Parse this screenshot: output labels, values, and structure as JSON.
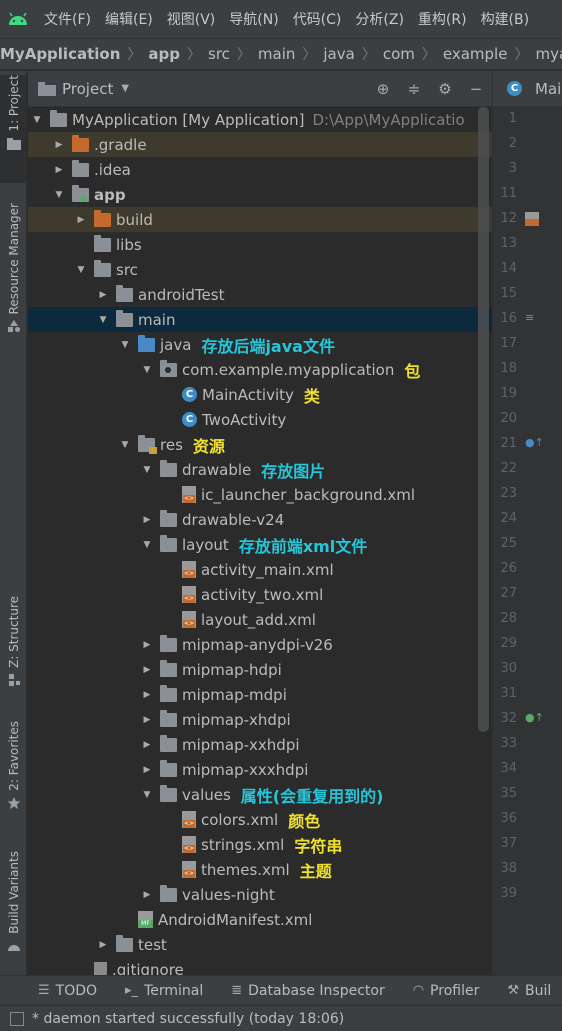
{
  "menubar": {
    "items": [
      "文件(F)",
      "编辑(E)",
      "视图(V)",
      "导航(N)",
      "代码(C)",
      "分析(Z)",
      "重构(R)",
      "构建(B)"
    ]
  },
  "breadcrumb": [
    "MyApplication",
    "app",
    "src",
    "main",
    "java",
    "com",
    "example",
    "myapplicatio"
  ],
  "sidebar": {
    "tabs": [
      "1: Project",
      "Resource Manager",
      "Z: Structure",
      "2: Favorites",
      "Build Variants"
    ]
  },
  "project_panel": {
    "title": "Project",
    "tree": [
      {
        "label": "MyApplication [My Application]",
        "path": "D:\\App\\MyApplicatio",
        "depth": 0,
        "icon": "folder-gray",
        "arrow": "open"
      },
      {
        "label": ".gradle",
        "depth": 1,
        "icon": "folder-orange",
        "arrow": "closed",
        "hl": true
      },
      {
        "label": ".idea",
        "depth": 1,
        "icon": "folder-gray",
        "arrow": "closed"
      },
      {
        "label": "app",
        "depth": 1,
        "icon": "folder-app",
        "arrow": "open",
        "bold": true
      },
      {
        "label": "build",
        "depth": 2,
        "icon": "folder-orange",
        "arrow": "closed",
        "hl": true
      },
      {
        "label": "libs",
        "depth": 2,
        "icon": "folder-gray",
        "arrow": "none"
      },
      {
        "label": "src",
        "depth": 2,
        "icon": "folder-gray",
        "arrow": "open"
      },
      {
        "label": "androidTest",
        "depth": 3,
        "icon": "folder-gray",
        "arrow": "closed"
      },
      {
        "label": "main",
        "depth": 3,
        "icon": "folder-gray",
        "arrow": "open",
        "sel": true
      },
      {
        "label": "java",
        "depth": 4,
        "icon": "folder-blue",
        "arrow": "open",
        "note": "存放后端java文件",
        "note_color": "cyan"
      },
      {
        "label": "com.example.myapplication",
        "depth": 5,
        "icon": "package",
        "arrow": "open",
        "note": "包",
        "note_color": "yellow"
      },
      {
        "label": "MainActivity",
        "depth": 6,
        "icon": "class",
        "arrow": "none",
        "note": "类",
        "note_color": "yellow"
      },
      {
        "label": "TwoActivity",
        "depth": 6,
        "icon": "class",
        "arrow": "none"
      },
      {
        "label": "res",
        "depth": 4,
        "icon": "folder-res",
        "arrow": "open",
        "note": "资源",
        "note_color": "yellow"
      },
      {
        "label": "drawable",
        "depth": 5,
        "icon": "folder-gray",
        "arrow": "open",
        "note": "存放图片",
        "note_color": "cyan"
      },
      {
        "label": "ic_launcher_background.xml",
        "depth": 6,
        "icon": "xml",
        "arrow": "none"
      },
      {
        "label": "drawable-v24",
        "depth": 5,
        "icon": "folder-gray",
        "arrow": "closed"
      },
      {
        "label": "layout",
        "depth": 5,
        "icon": "folder-gray",
        "arrow": "open",
        "note": "存放前端xml文件",
        "note_color": "cyan"
      },
      {
        "label": "activity_main.xml",
        "depth": 6,
        "icon": "xml",
        "arrow": "none"
      },
      {
        "label": "activity_two.xml",
        "depth": 6,
        "icon": "xml",
        "arrow": "none"
      },
      {
        "label": "layout_add.xml",
        "depth": 6,
        "icon": "xml",
        "arrow": "none"
      },
      {
        "label": "mipmap-anydpi-v26",
        "depth": 5,
        "icon": "folder-gray",
        "arrow": "closed"
      },
      {
        "label": "mipmap-hdpi",
        "depth": 5,
        "icon": "folder-gray",
        "arrow": "closed"
      },
      {
        "label": "mipmap-mdpi",
        "depth": 5,
        "icon": "folder-gray",
        "arrow": "closed"
      },
      {
        "label": "mipmap-xhdpi",
        "depth": 5,
        "icon": "folder-gray",
        "arrow": "closed"
      },
      {
        "label": "mipmap-xxhdpi",
        "depth": 5,
        "icon": "folder-gray",
        "arrow": "closed"
      },
      {
        "label": "mipmap-xxxhdpi",
        "depth": 5,
        "icon": "folder-gray",
        "arrow": "closed"
      },
      {
        "label": "values",
        "depth": 5,
        "icon": "folder-gray",
        "arrow": "open",
        "note": "属性(会重复用到的)",
        "note_color": "cyan"
      },
      {
        "label": "colors.xml",
        "depth": 6,
        "icon": "xml",
        "arrow": "none",
        "note": "颜色",
        "note_color": "yellow"
      },
      {
        "label": "strings.xml",
        "depth": 6,
        "icon": "xml",
        "arrow": "none",
        "note": "字符串",
        "note_color": "yellow"
      },
      {
        "label": "themes.xml",
        "depth": 6,
        "icon": "xml",
        "arrow": "none",
        "note": "主题",
        "note_color": "yellow"
      },
      {
        "label": "values-night",
        "depth": 5,
        "icon": "folder-gray",
        "arrow": "closed"
      },
      {
        "label": "AndroidManifest.xml",
        "depth": 4,
        "icon": "manifest",
        "arrow": "none"
      },
      {
        "label": "test",
        "depth": 3,
        "icon": "folder-gray",
        "arrow": "closed"
      },
      {
        "label": ".gitignore",
        "depth": 2,
        "icon": "text",
        "arrow": "none"
      }
    ]
  },
  "editor": {
    "tab_label": "Main",
    "line_numbers": [
      "1",
      "2",
      "3",
      "11",
      "12",
      "13",
      "14",
      "15",
      "16",
      "17",
      "18",
      "19",
      "20",
      "21",
      "22",
      "23",
      "24",
      "25",
      "26",
      "27",
      "28",
      "29",
      "30",
      "31",
      "32",
      "33",
      "34",
      "35",
      "36",
      "37",
      "38",
      "39"
    ]
  },
  "bottom_tabs": [
    "TODO",
    "Terminal",
    "Database Inspector",
    "Profiler",
    "Buil"
  ],
  "status": {
    "message": "* daemon started successfully (today 18:06)"
  },
  "colors": {
    "background": "#2b2b2b",
    "panel": "#3c3f41",
    "selection": "#0d293e",
    "annotation_cyan": "#26c6da",
    "annotation_yellow": "#f0e030"
  }
}
